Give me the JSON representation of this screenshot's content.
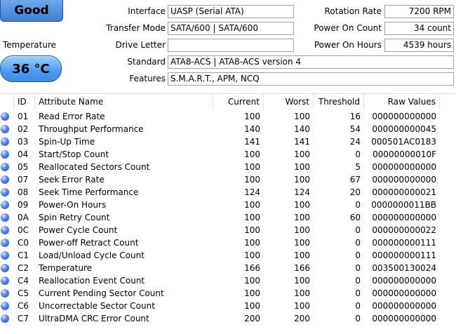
{
  "health": {
    "status": "Good"
  },
  "temperature": {
    "label": "Temperature",
    "value": "36 °C"
  },
  "info": {
    "interface_label": "Interface",
    "interface_value": "UASP (Serial ATA)",
    "transfer_label": "Transfer Mode",
    "transfer_value": "SATA/600 | SATA/600",
    "drive_letter_label": "Drive Letter",
    "drive_letter_value": "",
    "standard_label": "Standard",
    "standard_value": "ATA8-ACS | ATA8-ACS version 4",
    "features_label": "Features",
    "features_value": "S.M.A.R.T., APM, NCQ",
    "rotation_label": "Rotation Rate",
    "rotation_value": "7200 RPM",
    "power_count_label": "Power On Count",
    "power_count_value": "34 count",
    "power_hours_label": "Power On Hours",
    "power_hours_value": "4539 hours"
  },
  "table": {
    "headers": {
      "id": "ID",
      "name": "Attribute Name",
      "current": "Current",
      "worst": "Worst",
      "threshold": "Threshold",
      "raw": "Raw Values"
    },
    "rows": [
      {
        "id": "01",
        "name": "Read Error Rate",
        "current": "100",
        "worst": "100",
        "threshold": "16",
        "raw": "000000000000"
      },
      {
        "id": "02",
        "name": "Throughput Performance",
        "current": "140",
        "worst": "140",
        "threshold": "54",
        "raw": "000000000045"
      },
      {
        "id": "03",
        "name": "Spin-Up Time",
        "current": "141",
        "worst": "141",
        "threshold": "24",
        "raw": "000501AC0183"
      },
      {
        "id": "04",
        "name": "Start/Stop Count",
        "current": "100",
        "worst": "100",
        "threshold": "0",
        "raw": "00000000010F"
      },
      {
        "id": "05",
        "name": "Reallocated Sectors Count",
        "current": "100",
        "worst": "100",
        "threshold": "5",
        "raw": "000000000000"
      },
      {
        "id": "07",
        "name": "Seek Error Rate",
        "current": "100",
        "worst": "100",
        "threshold": "67",
        "raw": "000000000000"
      },
      {
        "id": "08",
        "name": "Seek Time Performance",
        "current": "124",
        "worst": "124",
        "threshold": "20",
        "raw": "000000000021"
      },
      {
        "id": "09",
        "name": "Power-On Hours",
        "current": "100",
        "worst": "100",
        "threshold": "0",
        "raw": "0000000011BB"
      },
      {
        "id": "0A",
        "name": "Spin Retry Count",
        "current": "100",
        "worst": "100",
        "threshold": "60",
        "raw": "000000000000"
      },
      {
        "id": "0C",
        "name": "Power Cycle Count",
        "current": "100",
        "worst": "100",
        "threshold": "0",
        "raw": "000000000022"
      },
      {
        "id": "C0",
        "name": "Power-off Retract Count",
        "current": "100",
        "worst": "100",
        "threshold": "0",
        "raw": "000000000111"
      },
      {
        "id": "C1",
        "name": "Load/Unload Cycle Count",
        "current": "100",
        "worst": "100",
        "threshold": "0",
        "raw": "000000000111"
      },
      {
        "id": "C2",
        "name": "Temperature",
        "current": "166",
        "worst": "166",
        "threshold": "0",
        "raw": "003500130024"
      },
      {
        "id": "C4",
        "name": "Reallocation Event Count",
        "current": "100",
        "worst": "100",
        "threshold": "0",
        "raw": "000000000000"
      },
      {
        "id": "C5",
        "name": "Current Pending Sector Count",
        "current": "100",
        "worst": "100",
        "threshold": "0",
        "raw": "000000000000"
      },
      {
        "id": "C6",
        "name": "Uncorrectable Sector Count",
        "current": "100",
        "worst": "100",
        "threshold": "0",
        "raw": "000000000000"
      },
      {
        "id": "C7",
        "name": "UltraDMA CRC Error Count",
        "current": "200",
        "worst": "200",
        "threshold": "0",
        "raw": "000000000000"
      }
    ]
  }
}
